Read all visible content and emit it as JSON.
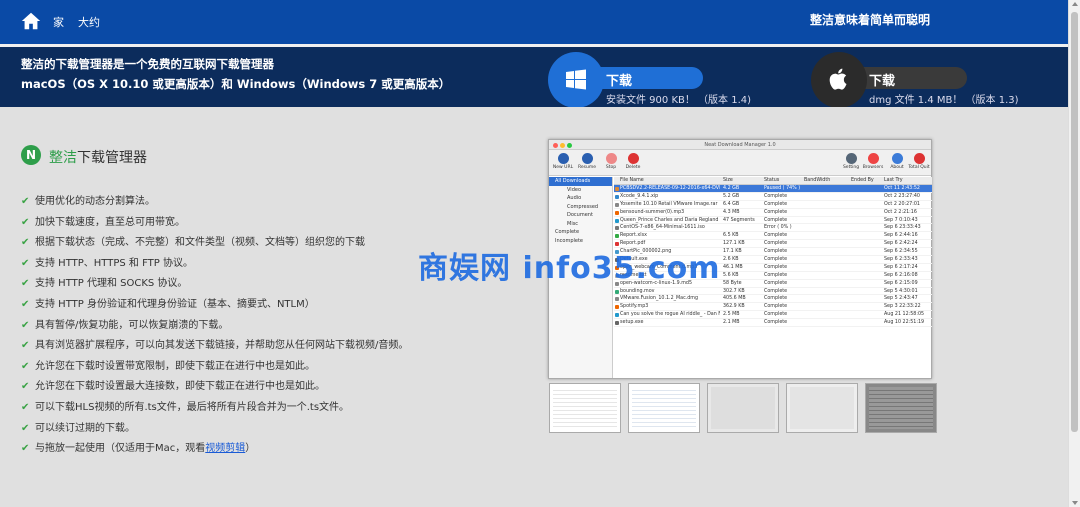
{
  "nav": {
    "items": [
      "家",
      "大约"
    ],
    "slogan": "整洁意味着简单而聪明"
  },
  "hero": {
    "line1": "整洁的下载管理器是一个免费的互联网下载管理器",
    "line2": "macOS（OS X 10.10 或更高版本）和 Windows（Windows 7 或更高版本）",
    "windows": {
      "label": "下载",
      "sub": "安装文件 900 KB！ （版本 1.4)"
    },
    "mac": {
      "label": "下载",
      "sub": "dmg 文件 1.4 MB！ （版本 1.3)"
    }
  },
  "brand": {
    "logo": "N",
    "green": "整洁",
    "rest": "下载管理器"
  },
  "features": [
    "使用优化的动态分割算法。",
    "加快下载速度，直至总可用带宽。",
    "根据下载状态（完成、不完整）和文件类型（视频、文档等）组织您的下载",
    "支持 HTTP、HTTPS 和 FTP 协议。",
    "支持 HTTP 代理和 SOCKS 协议。",
    "支持 HTTP 身份验证和代理身份验证（基本、摘要式、NTLM）",
    "具有暂停/恢复功能，可以恢复崩溃的下载。",
    "具有浏览器扩展程序，可以向其发送下载链接，并帮助您从任何网站下载视频/音频。",
    "允许您在下载时设置带宽限制，即使下载正在进行中也是如此。",
    "允许您在下载时设置最大连接数，即使下载正在进行中也是如此。",
    "可以下载HLS视频的所有.ts文件，最后将所有片段合并为一个.ts文件。",
    "可以续订过期的下载。"
  ],
  "last_feature": {
    "prefix": "与拖放一起使用（仅适用于Mac，观看",
    "link": "视频剪辑",
    "suffix": "）"
  },
  "app": {
    "title": "Neat Download Manager 1.0",
    "toolbar": [
      "New URL",
      "Resume",
      "Stop",
      "Delete",
      "Setting",
      "Browsers",
      "About",
      "Total Quit"
    ],
    "sidebar": [
      "All Downloads",
      "Video",
      "Audio",
      "Compressed",
      "Document",
      "Misc",
      "Complete",
      "Incomplete"
    ],
    "columns": [
      "File Name",
      "Size",
      "Status",
      "BandWidth",
      "Ended By",
      "Last Try"
    ],
    "rows": [
      [
        "PCBSDV2.2-RELEASE-09-12-2016-x64-DVD",
        "4.2 GB",
        "Paused ( 74% )",
        "",
        "",
        "Oct 11  2:43:52"
      ],
      [
        "Xcode_9.4.1.xip",
        "5.2 GB",
        "Complete",
        "",
        "",
        "Oct 2  23:27:40"
      ],
      [
        "Yosemite 10.10 Retail VMware Image.rar",
        "6.4 GB",
        "Complete",
        "",
        "",
        "Oct 2  20:27:01"
      ],
      [
        "bensound-summer(0).mp3",
        "4.3 MB",
        "Complete",
        "",
        "",
        "Oct 2  2:21:16"
      ],
      [
        "Queen_Prince Charles and Daria Regland on",
        "47 Segments",
        "Complete",
        "",
        "",
        "Sep 7  0:10:43"
      ],
      [
        "CentOS-7-x86_64-Minimal-1611.iso",
        "",
        "Error ( 0% )",
        "",
        "",
        "Sep 6  23:33:43"
      ],
      [
        "Report.xlsx",
        "6.5 KB",
        "Complete",
        "",
        "",
        "Sep 6  2:44:16"
      ],
      [
        "Report.pdf",
        "127.1 KB",
        "Complete",
        "",
        "",
        "Sep 6  2:42:24"
      ],
      [
        "ChartPic_000002.png",
        "17.1 KB",
        "Complete",
        "",
        "",
        "Sep 6  2:34:55"
      ],
      [
        "Default.exe",
        "2.6 KB",
        "Complete",
        "",
        "",
        "Sep 6  2:33:43"
      ],
      [
        "open_webcam_Comment.d.mp3",
        "46.1 MB",
        "Complete",
        "",
        "",
        "Sep 6  2:17:24"
      ],
      [
        "readme.txt",
        "5.6 KB",
        "Complete",
        "",
        "",
        "Sep 6  2:16:08"
      ],
      [
        "open-watcom-c-linux-1.9.md5",
        "58 Byte",
        "Complete",
        "",
        "",
        "Sep 6  2:15:09"
      ],
      [
        "bounding.mov",
        "302.7 KB",
        "Complete",
        "",
        "",
        "Sep 5  4:30:01"
      ],
      [
        "VMware.Fusion_10.1.2_Mac.dmg",
        "405.6 MB",
        "Complete",
        "",
        "",
        "Sep 5  2:43:47"
      ],
      [
        "Spotify.mp3",
        "362.9 KB",
        "Complete",
        "",
        "",
        "Sep 3  22:33:22"
      ],
      [
        "Can you solve the rogue AI riddle_ - Dan Fi",
        "2.5 MB",
        "Complete",
        "",
        "",
        "Aug 21  12:58:05"
      ],
      [
        "setup.exe",
        "2.1 MB",
        "Complete",
        "",
        "",
        "Aug 10  22:51:19"
      ]
    ]
  },
  "watermark": "商娱网 info35.com",
  "colors": {
    "nav": "#0a4aa6",
    "hero": "#0c2c5c",
    "windows_button": "#1f6fd6",
    "mac_button": "#2b2b2b",
    "check": "#3aa345",
    "brand_green": "#2e9e4a"
  }
}
